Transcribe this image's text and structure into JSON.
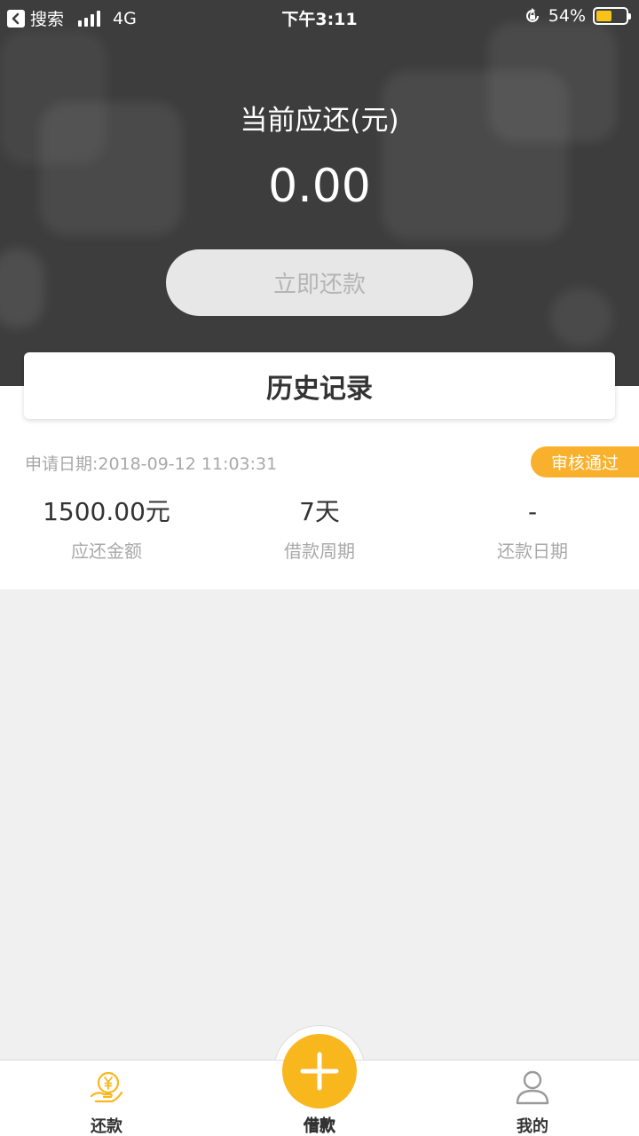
{
  "status_bar": {
    "back_app": "搜索",
    "network": "4G",
    "time": "下午3:11",
    "battery_percent": "54%",
    "battery_level": 0.54
  },
  "hero": {
    "title": "当前应还(元)",
    "amount": "0.00",
    "repay_button": "立即还款"
  },
  "history": {
    "title": "历史记录",
    "records": [
      {
        "apply_date": "申请日期:2018-09-12 11:03:31",
        "status": "审核通过",
        "amount": "1500.00元",
        "amount_label": "应还金额",
        "period": "7天",
        "period_label": "借款周期",
        "repay_date": "-",
        "repay_date_label": "还款日期"
      }
    ]
  },
  "tabs": {
    "repay": {
      "label": "还款",
      "icon": "yen-hand-icon"
    },
    "borrow": {
      "label": "借款",
      "icon": "plus-icon"
    },
    "mine": {
      "label": "我的",
      "icon": "user-icon"
    }
  },
  "colors": {
    "accent": "#f9b71e",
    "badge": "#f9b02c",
    "hero_bg": "#3d3d3d"
  }
}
